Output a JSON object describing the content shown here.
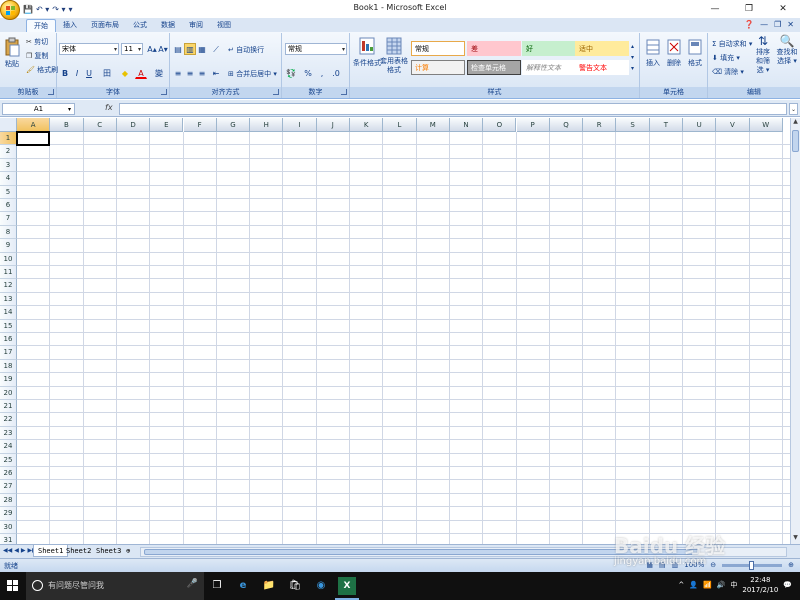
{
  "window": {
    "title": "Book1 - Microsoft Excel",
    "controls": [
      "—",
      "❐",
      "✕"
    ]
  },
  "qat": {
    "save": "💾",
    "undo": "↶ ▾",
    "redo": "↷ ▾",
    "customize": "▾"
  },
  "tabs": [
    {
      "label": "开始",
      "active": true
    },
    {
      "label": "插入"
    },
    {
      "label": "页面布局"
    },
    {
      "label": "公式"
    },
    {
      "label": "数据"
    },
    {
      "label": "审阅"
    },
    {
      "label": "视图"
    }
  ],
  "tab_right": {
    "help": "❓",
    "minimize": "—",
    "restore": "❐",
    "close": "✕"
  },
  "ribbon": {
    "clipboard": {
      "paste": "粘贴",
      "cut": "剪切",
      "copy": "复制",
      "format_painter": "格式刷",
      "label": "剪贴板"
    },
    "font": {
      "name": "宋体",
      "size": "11",
      "grow": "A▴",
      "shrink": "A▾",
      "bold": "B",
      "italic": "I",
      "underline": "U",
      "border": "田",
      "fill": "◆",
      "color": "A",
      "phonetic": "變",
      "label": "字体"
    },
    "alignment": {
      "wrap": "自动换行",
      "merge": "合并后居中",
      "label": "对齐方式"
    },
    "number": {
      "format": "常规",
      "percent": "%",
      "comma": ",",
      "currency": "💱",
      "label": "数字"
    },
    "styles": {
      "conditional": "条件格式",
      "table": "套用表格格式",
      "cells": [
        {
          "text": "常规",
          "bg": "#ffffff",
          "color": "#000000",
          "border": "#e8a94a"
        },
        {
          "text": "差",
          "bg": "#ffc7ce",
          "color": "#9c0006",
          "border": "#ffc7ce"
        },
        {
          "text": "好",
          "bg": "#c6efce",
          "color": "#006100",
          "border": "#c6efce"
        },
        {
          "text": "适中",
          "bg": "#ffeb9c",
          "color": "#9c6500",
          "border": "#ffeb9c"
        },
        {
          "text": "计算",
          "bg": "#f2f2f2",
          "color": "#fa7d00",
          "border": "#7f7f7f"
        },
        {
          "text": "检查单元格",
          "bg": "#a5a5a5",
          "color": "#ffffff",
          "border": "#3f3f3f"
        },
        {
          "text": "解释性文本",
          "bg": "#ffffff",
          "color": "#7f7f7f",
          "border": "#ffffff"
        },
        {
          "text": "警告文本",
          "bg": "#ffffff",
          "color": "#ff0000",
          "border": "#ffffff"
        }
      ],
      "label": "样式"
    },
    "cells": {
      "insert": "插入",
      "delete": "删除",
      "format": "格式",
      "label": "单元格"
    },
    "editing": {
      "autosum": "Σ 自动求和 ▾",
      "fill": "填充 ▾",
      "clear": "清除 ▾",
      "sort": "排序和筛选 ▾",
      "find": "查找和选择 ▾",
      "label": "编辑"
    }
  },
  "formula_bar": {
    "name_box": "A1",
    "fx": "fx",
    "value": ""
  },
  "columns": [
    "A",
    "B",
    "C",
    "D",
    "E",
    "F",
    "G",
    "H",
    "I",
    "J",
    "K",
    "L",
    "M",
    "N",
    "O",
    "P",
    "Q",
    "R",
    "S",
    "T",
    "U",
    "V",
    "W"
  ],
  "rows": [
    "1",
    "2",
    "3",
    "4",
    "5",
    "6",
    "7",
    "8",
    "9",
    "10",
    "11",
    "12",
    "13",
    "14",
    "15",
    "16",
    "17",
    "18",
    "19",
    "20",
    "21",
    "22",
    "23",
    "24",
    "25",
    "26",
    "27",
    "28",
    "29",
    "30",
    "31"
  ],
  "active_cell": "A1",
  "sheets": [
    {
      "label": "Sheet1",
      "active": true
    },
    {
      "label": "Sheet2"
    },
    {
      "label": "Sheet3"
    }
  ],
  "status": {
    "text": "就绪",
    "zoom": "100%"
  },
  "taskbar": {
    "search_placeholder": "有问题尽管问我",
    "time": "22:48",
    "date": "2017/2/10",
    "ime": "中"
  },
  "watermark": {
    "text": "Baidu 经验",
    "url": "jingyan.baidu.com"
  },
  "colors": {
    "ribbon": "#d7e4f4",
    "accent": "#15428b",
    "grid": "#d0d7e5"
  }
}
